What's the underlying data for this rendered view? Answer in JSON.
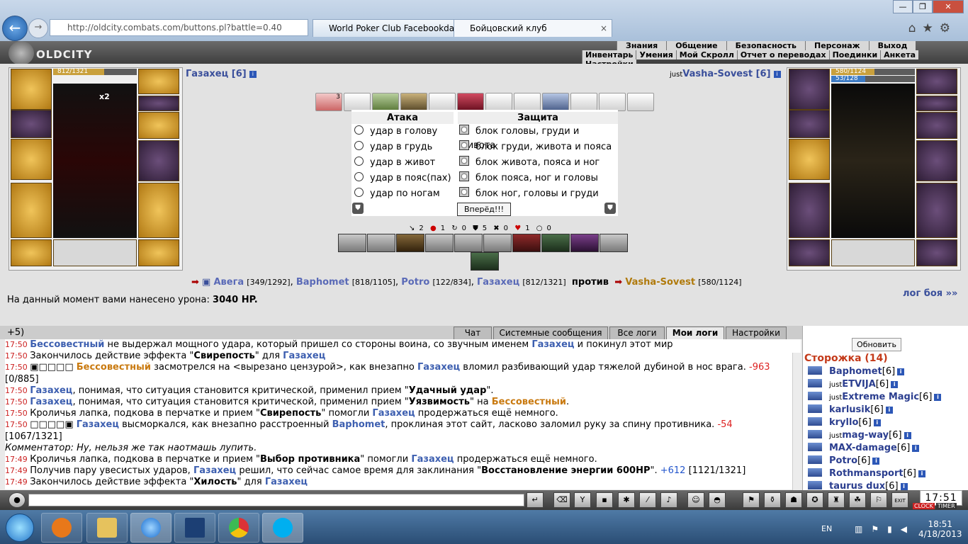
{
  "browser": {
    "address": "http://oldcity.combats.com/buttons.pl?battle=0.40",
    "address_domain": "combats.com",
    "tabs": [
      {
        "label": "World Poker Club Facebookda"
      },
      {
        "label": "Бойцовский клуб"
      }
    ],
    "window_buttons": [
      "—",
      "❐",
      "✕"
    ],
    "nav_icons": [
      "home-icon",
      "star-icon",
      "gear-icon"
    ]
  },
  "game_menu": {
    "logo": "OLDCITY",
    "top_items": [
      "Знания",
      "Общение",
      "Безопасность",
      "Персонаж",
      "Выход"
    ],
    "sub_items": [
      "Инвентарь",
      "Умения",
      "Мой Скролл",
      "Отчет о переводах",
      "Поединки",
      "Анкета",
      "Настройки"
    ]
  },
  "player": {
    "name": "Газахец [6]",
    "hp": "812/1321",
    "hp_fraction": 0.61,
    "buff_count": "x2"
  },
  "opponent": {
    "prefix": "just",
    "name": "Vasha-Sovest [6]",
    "hp": "580/1124",
    "mp": "53/128",
    "hp_fraction": 0.52,
    "mp_fraction": 0.41
  },
  "combat": {
    "attack_header": "Атака",
    "defense_header": "Защита",
    "attacks": [
      "удар в голову",
      "удар в грудь",
      "удар в живот",
      "удар в пояс(пах)",
      "удар по ногам"
    ],
    "defenses": [
      "блок головы, груди и живота",
      "блок груди, живота и пояса",
      "блок живота, пояса и ног",
      "блок пояса, ног и головы",
      "блок ног, головы и груди"
    ],
    "go_button": "Вперёд!!!",
    "card_count": "3",
    "stats": [
      "2",
      "1",
      "0",
      "5",
      "0",
      "1",
      "0"
    ]
  },
  "vs": {
    "team": [
      {
        "name": "Авега",
        "hp": "[349/1292]"
      },
      {
        "name": "Baphomet",
        "hp": "[818/1105]"
      },
      {
        "name": "Potro",
        "hp": "[122/834]"
      },
      {
        "name": "Газахец",
        "hp": "[812/1321]"
      }
    ],
    "versus_word": "против",
    "enemy": {
      "name": "Vasha-Sovest",
      "hp": "[580/1124]"
    }
  },
  "damage": {
    "text": "На данный момент вами нанесено урона: ",
    "value": "3040 HP."
  },
  "battle_log_link": "лог боя »»",
  "chat": {
    "tabs": [
      "Чат",
      "Системные сообщения",
      "Все логи",
      "Мои логи",
      "Настройки"
    ],
    "active_tab": "Мои логи",
    "lines": [
      {
        "t": "",
        "segs": [
          [
            "",
            "+5)"
          ]
        ]
      },
      {
        "t": "17:50",
        "segs": [
          [
            "nb",
            "Бессовестный"
          ],
          [
            "",
            " не выдержал мощного удара, который пришел со стороны воина, со звучным именем "
          ],
          [
            "nb",
            "Газахец"
          ],
          [
            "",
            " и покинул этот мир"
          ]
        ]
      },
      {
        "t": "17:50",
        "segs": [
          [
            "",
            "Закончилось действие эффекта \""
          ],
          [
            "b",
            "Свирепость"
          ],
          [
            "",
            "\" для "
          ],
          [
            "nb",
            "Газахец"
          ]
        ]
      },
      {
        "t": "17:50",
        "segs": [
          [
            "",
            "▣□□□□ "
          ],
          [
            "no",
            "Бессовестный"
          ],
          [
            "",
            " засмотрелся на <вырезано цензурой>, как внезапно "
          ],
          [
            "nb",
            "Газахец"
          ],
          [
            "",
            " вломил разбивающий удар тяжелой дубиной в нос врага. "
          ],
          [
            "dmg",
            "-963"
          ]
        ]
      },
      {
        "t": "",
        "segs": [
          [
            "",
            "[0/885]"
          ]
        ]
      },
      {
        "t": "17:50",
        "segs": [
          [
            "nb",
            "Газахец"
          ],
          [
            "",
            ", понимая, что ситуация становится критической, применил прием \""
          ],
          [
            "b",
            "Удачный удар"
          ],
          [
            "",
            "\"."
          ]
        ]
      },
      {
        "t": "17:50",
        "segs": [
          [
            "nb",
            "Газахец"
          ],
          [
            "",
            ", понимая, что ситуация становится критической, применил прием \""
          ],
          [
            "b",
            "Уязвимость"
          ],
          [
            "",
            "\" на "
          ],
          [
            "no",
            "Бессовестный"
          ],
          [
            "",
            "."
          ]
        ]
      },
      {
        "t": "17:50",
        "segs": [
          [
            "",
            "Кроличья лапка, подкова в перчатке и прием \""
          ],
          [
            "b",
            "Свирепость"
          ],
          [
            "",
            "\" помогли "
          ],
          [
            "nb",
            "Газахец"
          ],
          [
            "",
            " продержаться ещё немного."
          ]
        ]
      },
      {
        "t": "17:50",
        "segs": [
          [
            "",
            "□□□□▣ "
          ],
          [
            "nb",
            "Газахец"
          ],
          [
            "",
            " высморкался, как внезапно расстроенный "
          ],
          [
            "nb",
            "Baphomet"
          ],
          [
            "",
            ", проклиная этот сайт, ласково заломил руку за спину противника. "
          ],
          [
            "dmg",
            "-54"
          ]
        ]
      },
      {
        "t": "",
        "segs": [
          [
            "",
            "[1067/1321]"
          ]
        ]
      },
      {
        "t": "",
        "segs": [
          [
            "i",
            "Комментатор: Ну, нельзя же так наотмашь лупить."
          ]
        ]
      },
      {
        "t": "17:49",
        "segs": [
          [
            "",
            "Кроличья лапка, подкова в перчатке и прием \""
          ],
          [
            "b",
            "Выбор противника"
          ],
          [
            "",
            "\" помогли "
          ],
          [
            "nb",
            "Газахец"
          ],
          [
            "",
            " продержаться ещё немного."
          ]
        ]
      },
      {
        "t": "17:49",
        "segs": [
          [
            "",
            "Получив пару увесистых ударов, "
          ],
          [
            "nb",
            "Газахец"
          ],
          [
            "",
            " решил, что сейчас самое время для заклинания \""
          ],
          [
            "b",
            "Восстановление энергии 600HP"
          ],
          [
            "",
            "\". "
          ],
          [
            "heal",
            "+612"
          ],
          [
            "",
            " [1121/1321]"
          ]
        ]
      },
      {
        "t": "17:49",
        "segs": [
          [
            "",
            "Закончилось действие эффекта \""
          ],
          [
            "b",
            "Хилость"
          ],
          [
            "",
            "\" для "
          ],
          [
            "nb",
            "Газахец"
          ]
        ]
      }
    ]
  },
  "watch": {
    "refresh_button": "Обновить",
    "title": "Сторожка (14)",
    "users": [
      {
        "pre": "",
        "name": "Baphomet",
        "lv": "[6]"
      },
      {
        "pre": "just",
        "name": "ETVIJA",
        "lv": "[6]"
      },
      {
        "pre": "just",
        "name": "Extreme Magic",
        "lv": "[6]"
      },
      {
        "pre": "",
        "name": "karlusik",
        "lv": "[6]"
      },
      {
        "pre": "",
        "name": "kryllo",
        "lv": "[6]"
      },
      {
        "pre": "just",
        "name": "mag-way",
        "lv": "[6]"
      },
      {
        "pre": "",
        "name": "MAX-damage",
        "lv": "[6]"
      },
      {
        "pre": "",
        "name": "Potro",
        "lv": "[6]"
      },
      {
        "pre": "",
        "name": "Rothmansport",
        "lv": "[6]"
      },
      {
        "pre": "",
        "name": "taurus dux",
        "lv": "[6]"
      }
    ]
  },
  "clock": {
    "time": "17:51",
    "label_clock": "CLOCK",
    "label_timer": "TIMER",
    "exit": "EXIT"
  },
  "taskbar": {
    "lang": "EN",
    "time": "18:51",
    "date": "4/18/2013"
  }
}
